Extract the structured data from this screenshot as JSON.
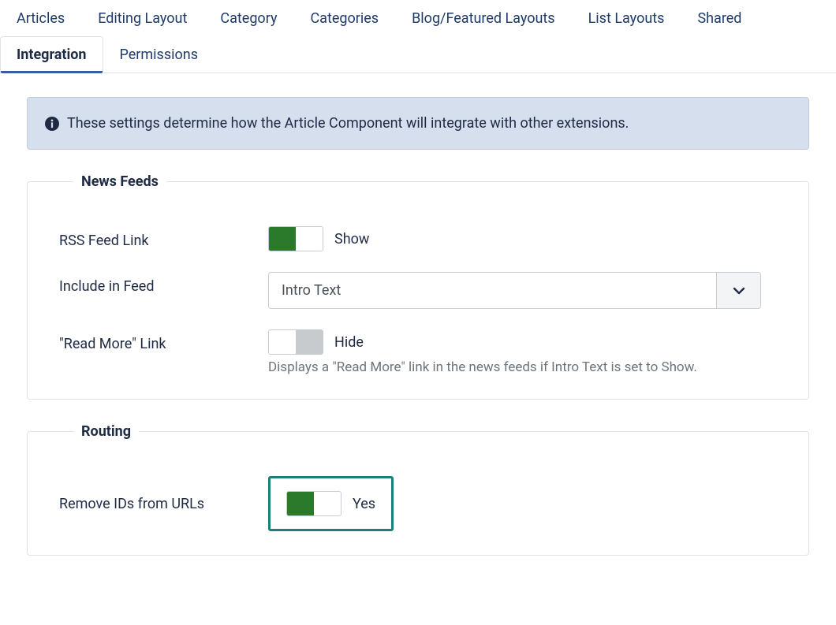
{
  "tabs": [
    {
      "label": "Articles"
    },
    {
      "label": "Editing Layout"
    },
    {
      "label": "Category"
    },
    {
      "label": "Categories"
    },
    {
      "label": "Blog/Featured Layouts"
    },
    {
      "label": "List Layouts"
    },
    {
      "label": "Shared"
    },
    {
      "label": "Integration",
      "active": true
    },
    {
      "label": "Permissions"
    }
  ],
  "banner": {
    "text": "These settings determine how the Article Component will integrate with other extensions."
  },
  "news_feeds": {
    "legend": "News Feeds",
    "rss_label": "RSS Feed Link",
    "rss_state": "Show",
    "include_label": "Include in Feed",
    "include_value": "Intro Text",
    "readmore_label": "\"Read More\" Link",
    "readmore_state": "Hide",
    "readmore_helper": "Displays a \"Read More\" link in the news feeds if Intro Text is set to Show."
  },
  "routing": {
    "legend": "Routing",
    "remove_ids_label": "Remove IDs from URLs",
    "remove_ids_state": "Yes"
  }
}
